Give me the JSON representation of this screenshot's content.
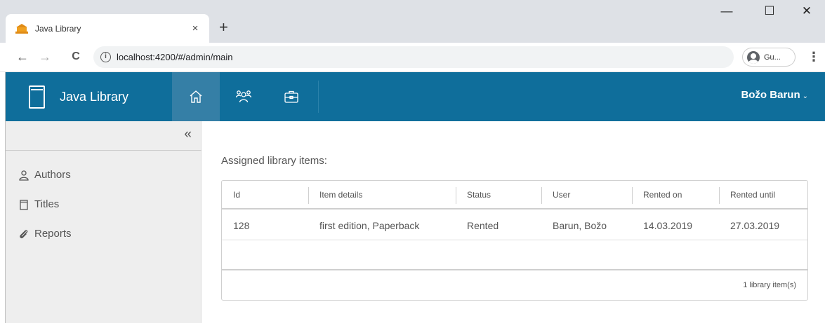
{
  "browser": {
    "tab_title": "Java Library",
    "tab_close": "×",
    "new_tab": "+",
    "window_controls": {
      "minimize": "—",
      "maximize": "☐",
      "close": "✕"
    },
    "back": "←",
    "forward": "→",
    "reload": "C",
    "url": "localhost:4200/#/admin/main",
    "profile_name": "Gu...",
    "menu": "⋮"
  },
  "app": {
    "brand_name": "Java Library",
    "user_name": "Božo Barun",
    "user_caret": "⌄",
    "colors": {
      "header": "#0f6e9b",
      "header_active": "#357fa6",
      "sidebar": "#eeeeee"
    },
    "nav_icons": [
      "home-icon",
      "users-icon",
      "briefcase-icon"
    ]
  },
  "sidebar": {
    "collapse_label": "«",
    "items": [
      {
        "label": "Authors",
        "icon": "user-icon"
      },
      {
        "label": "Titles",
        "icon": "book-icon"
      },
      {
        "label": "Reports",
        "icon": "paperclip-icon"
      }
    ]
  },
  "main": {
    "title": "Assigned library items:",
    "columns": [
      "Id",
      "Item details",
      "Status",
      "User",
      "Rented on",
      "Rented until"
    ],
    "rows": [
      [
        "128",
        "first edition, Paperback",
        "Rented",
        "Barun, Božo",
        "14.03.2019",
        "27.03.2019"
      ]
    ],
    "footer": "1 library item(s)"
  }
}
